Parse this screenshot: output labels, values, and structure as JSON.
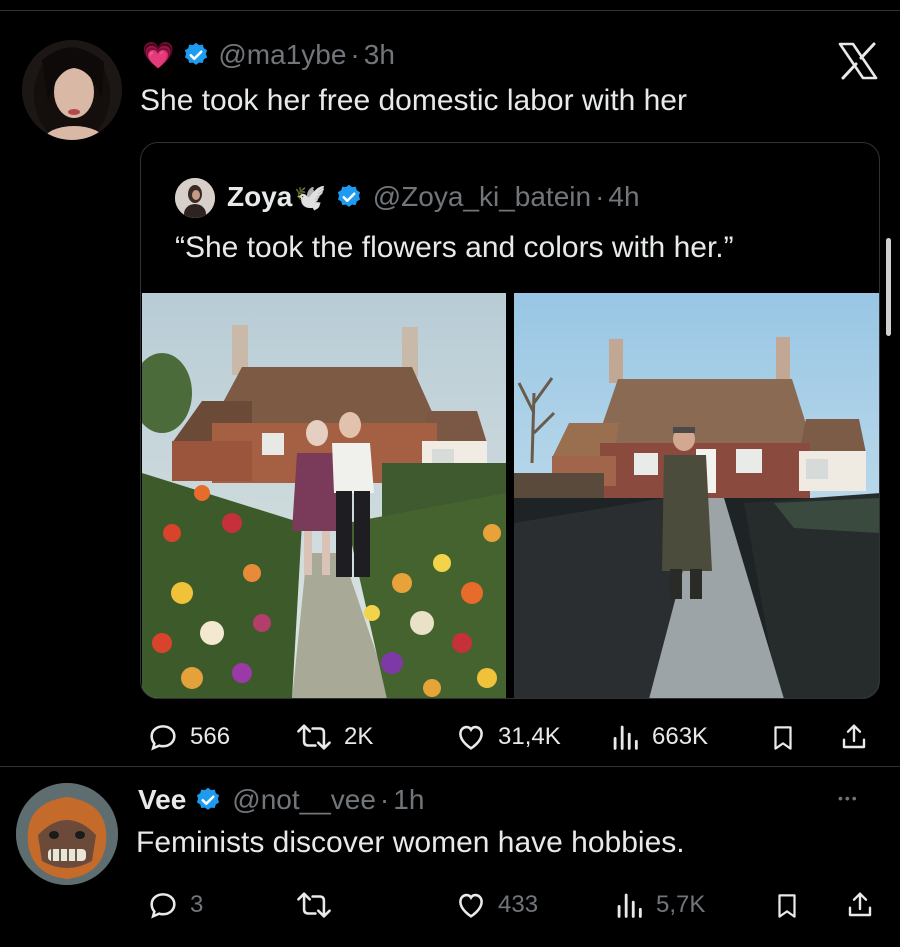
{
  "tweet": {
    "emoji": "💗",
    "handle": "@ma1ybe",
    "dot": "·",
    "time": "3h",
    "text": "She took her free domestic labor with her",
    "x_logo": "x-logo"
  },
  "quote": {
    "name": "Zoya",
    "name_emoji": "🕊️",
    "handle": "@Zoya_ki_batein",
    "dot": "·",
    "time": "4h",
    "text": "“She took the flowers and colors with her.”"
  },
  "tweet_actions": {
    "replies": "566",
    "retweets": "2K",
    "likes": "31,4K",
    "views": "663K"
  },
  "reply": {
    "name": "Vee",
    "handle": "@not__vee",
    "dot": "·",
    "time": "1h",
    "text": "Feminists discover women have hobbies.",
    "more": "•••"
  },
  "reply_actions": {
    "replies": "3",
    "retweets": "",
    "likes": "433",
    "views": "5,7K"
  },
  "colors": {
    "background": "#000000",
    "text": "#e7e9ea",
    "muted": "#71767b",
    "verified": "#1d9bf0",
    "border": "#2f3336"
  }
}
